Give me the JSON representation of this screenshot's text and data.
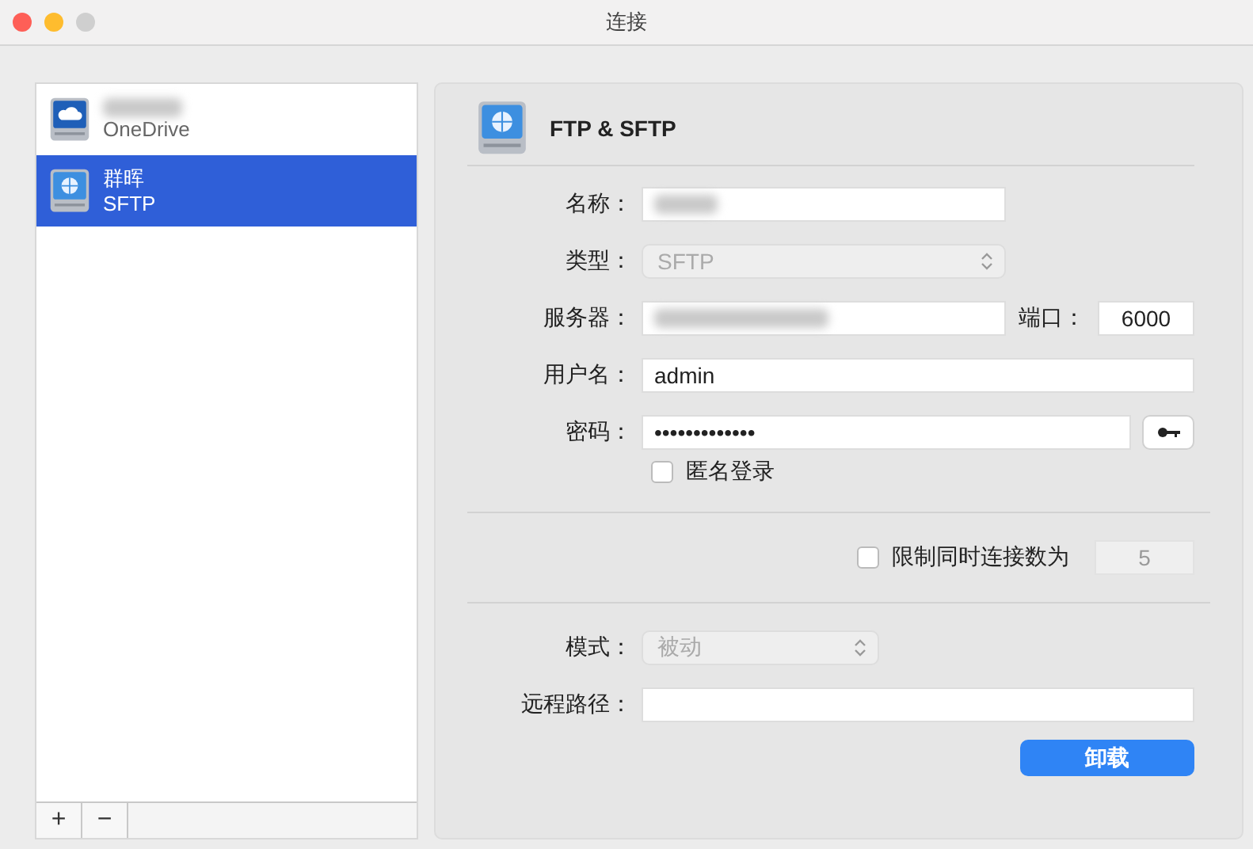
{
  "window": {
    "title": "连接"
  },
  "sidebar": {
    "items": [
      {
        "name_redacted": true,
        "type": "OneDrive",
        "selected": false
      },
      {
        "name": "群晖",
        "type": "SFTP",
        "selected": true
      }
    ],
    "footer_buttons": [
      "+",
      "−"
    ]
  },
  "connection": {
    "title": "FTP & SFTP",
    "fields": [
      {
        "kind": "text",
        "label": "名称：",
        "redacted": true
      },
      {
        "kind": "select",
        "label": "类型：",
        "value": "SFTP",
        "disabled": true
      },
      {
        "kind": "server",
        "label": "服务器：",
        "redacted": true,
        "port_label": "端口：",
        "port": "6000"
      },
      {
        "kind": "text",
        "label": "用户名：",
        "value": "admin"
      },
      {
        "kind": "password",
        "label": "密码：",
        "value": "•••••••••••••"
      }
    ],
    "anonymous": {
      "label": "匿名登录",
      "checked": false
    },
    "limit": {
      "label": "限制同时连接数为",
      "checked": false,
      "value": "5"
    },
    "advanced_fields": [
      {
        "kind": "select",
        "label": "模式：",
        "value": "被动",
        "disabled": true
      },
      {
        "kind": "text",
        "label": "远程路径："
      }
    ],
    "button": "卸载"
  }
}
